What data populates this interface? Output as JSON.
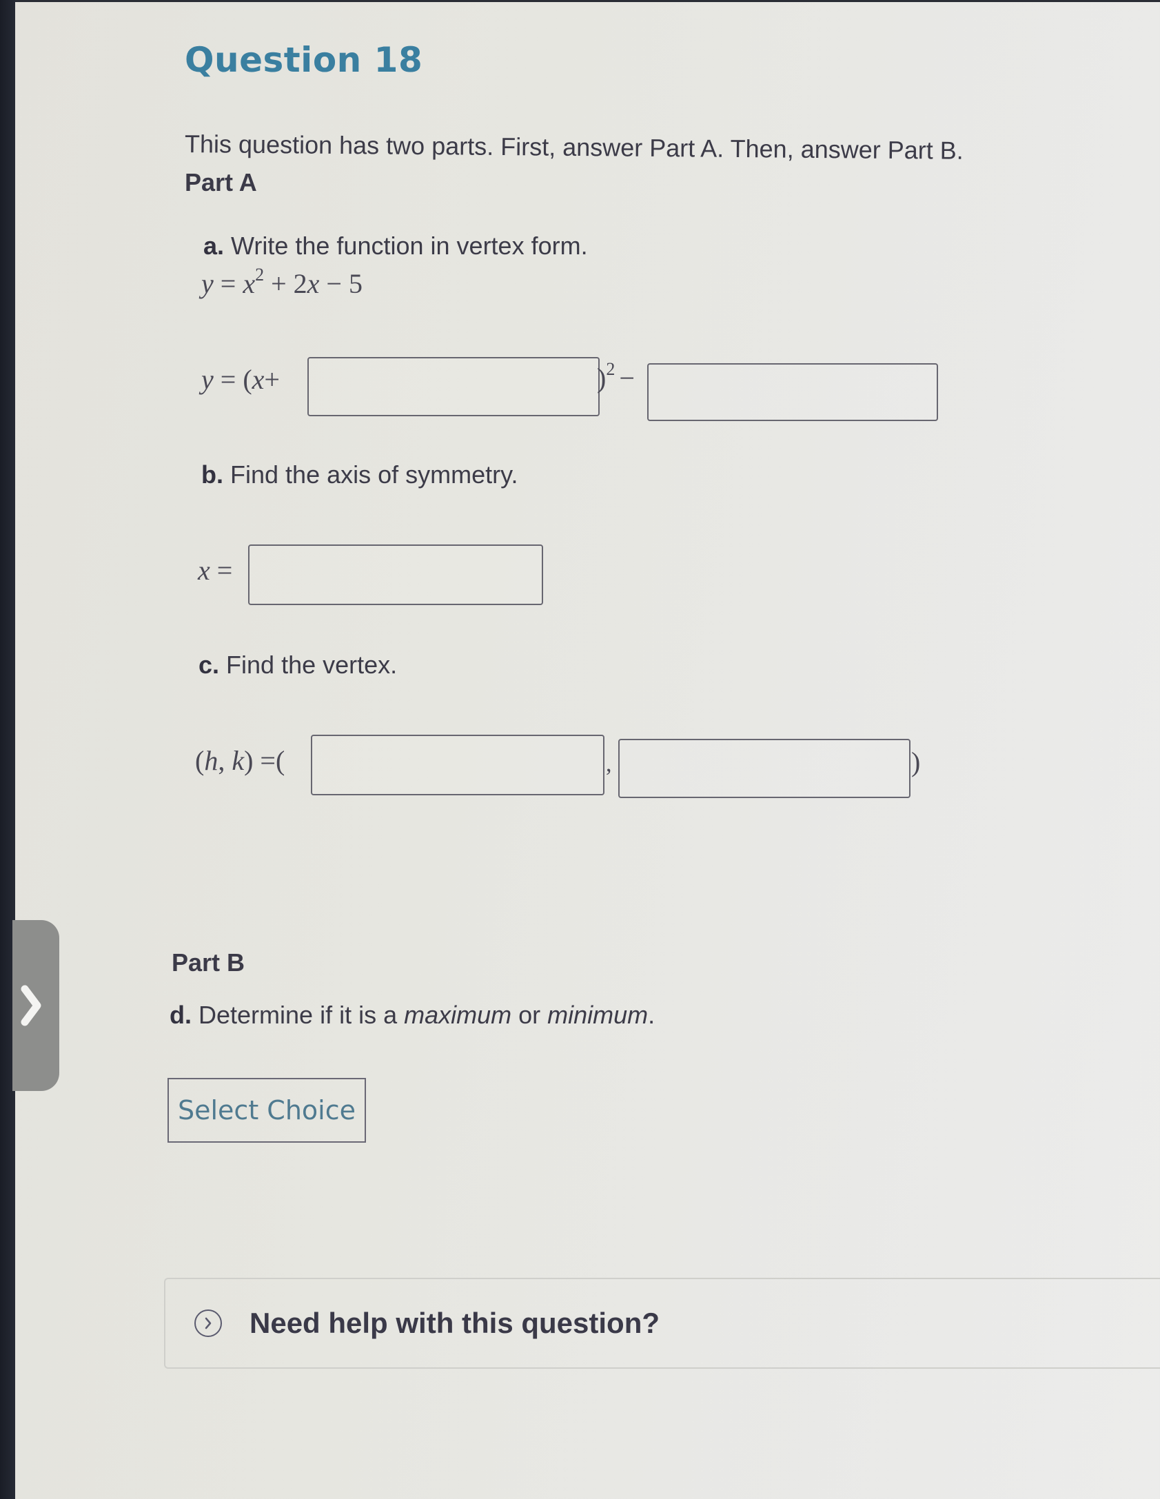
{
  "question": {
    "title": "Question 18",
    "intro": "This question has two parts. First, answer Part A. Then, answer Part B."
  },
  "part_a": {
    "label": "Part A",
    "a": {
      "letter": "a.",
      "prompt": "Write the function in vertex form.",
      "given": {
        "y": "y",
        "eq": "=",
        "x": "x",
        "exp": "2",
        "rest": "+ 2",
        "x2": "x",
        "tail": "− 5"
      },
      "answer_prefix": {
        "y": "y",
        "eq": "= (",
        "x": "x",
        "plus": "+"
      },
      "answer_mid": {
        "close": ")",
        "exp": "2",
        "minus": "−"
      },
      "input1": {
        "value": "",
        "placeholder": ""
      },
      "input2": {
        "value": "",
        "placeholder": ""
      }
    },
    "b": {
      "letter": "b.",
      "prompt": "Find the axis of symmetry.",
      "answer_prefix": {
        "x": "x",
        "eq": "="
      },
      "input": {
        "value": "",
        "placeholder": ""
      }
    },
    "c": {
      "letter": "c.",
      "prompt": "Find the vertex.",
      "answer_prefix": {
        "open": "(",
        "h": "h",
        "comma": ",",
        "k": "k",
        "close": ")",
        "eq": "=("
      },
      "separator": ",",
      "closing": ")",
      "input_h": {
        "value": "",
        "placeholder": ""
      },
      "input_k": {
        "value": "",
        "placeholder": ""
      }
    }
  },
  "part_b": {
    "label": "Part B",
    "d": {
      "letter": "d.",
      "prompt_start": "Determine if it is a ",
      "word1": "maximum",
      "middle": " or ",
      "word2": "minimum",
      "end": "."
    },
    "select_label": "Select Choice"
  },
  "help": {
    "label": "Need help with this question?",
    "icon": "chevron-right-circle-icon"
  },
  "side_tab": {
    "icon": "chevron-right-icon"
  },
  "colors": {
    "title": "#3a7fa0",
    "text": "#3c3b48",
    "select_text": "#4f7a90",
    "side_tab": "#8d8e8c"
  }
}
